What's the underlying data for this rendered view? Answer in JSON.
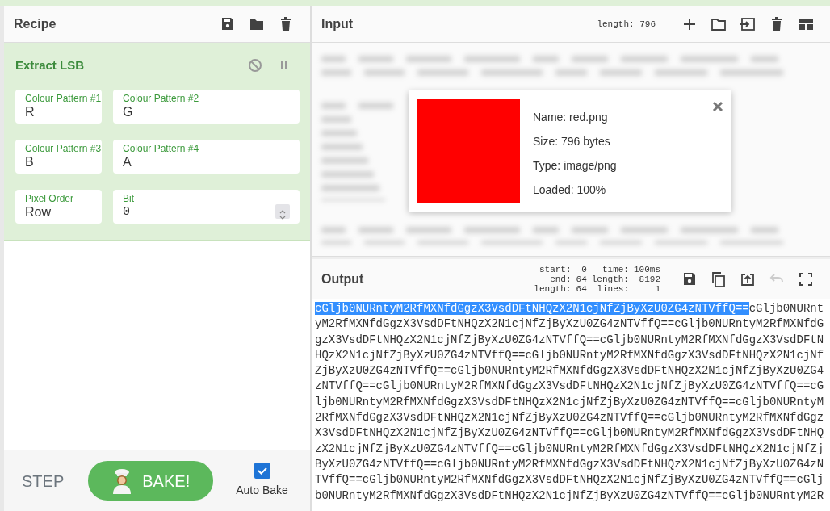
{
  "recipe": {
    "title": "Recipe",
    "buttons": [
      {
        "kind": "save"
      },
      {
        "kind": "folder"
      },
      {
        "kind": "trash"
      }
    ]
  },
  "operation": {
    "name": "Extract LSB",
    "buttons": [
      {
        "kind": "disable"
      },
      {
        "kind": "pause"
      }
    ],
    "fields": [
      {
        "label": "Colour Pattern #1",
        "value": "R",
        "kind": "text"
      },
      {
        "label": "Colour Pattern #2",
        "value": "G",
        "kind": "text"
      },
      {
        "label": "Colour Pattern #3",
        "value": "B",
        "kind": "text"
      },
      {
        "label": "Colour Pattern #4",
        "value": "A",
        "kind": "text"
      },
      {
        "label": "Pixel Order",
        "value": "Row",
        "kind": "text"
      },
      {
        "label": "Bit",
        "value": "0",
        "kind": "number"
      }
    ]
  },
  "controls": {
    "step": "STEP",
    "bake": "BAKE!",
    "auto_bake": {
      "label": "Auto Bake",
      "checked": true
    }
  },
  "input": {
    "title": "Input",
    "length": "length: 796",
    "buttons": [
      {
        "kind": "add"
      },
      {
        "kind": "folder-outline"
      },
      {
        "kind": "import"
      },
      {
        "kind": "trash"
      },
      {
        "kind": "layout"
      }
    ],
    "file": {
      "name": "Name: red.png",
      "size": "Size: 796 bytes",
      "type": "Type: image/png",
      "loaded": "Loaded: 100%",
      "color": "#ff0000"
    }
  },
  "output": {
    "title": "Output",
    "stats": [
      {
        "label": "start:",
        "value": "0"
      },
      {
        "label": "end:",
        "value": "64"
      },
      {
        "label": "length:",
        "value": "64"
      },
      {
        "label": "time:",
        "value": "100ms"
      },
      {
        "label": "length:",
        "value": "8192"
      },
      {
        "label": "lines:",
        "value": "1"
      }
    ],
    "buttons": [
      {
        "kind": "save",
        "disabled": false
      },
      {
        "kind": "copy",
        "disabled": false
      },
      {
        "kind": "replace",
        "disabled": false
      },
      {
        "kind": "undo",
        "disabled": true
      },
      {
        "kind": "maximise",
        "disabled": false
      }
    ],
    "selection": "cGljb0NURntyM2RfMXNfdGgzX3VsdDFtNHQzX2N1cjNfZjByXzU0ZG4zNTVffQ==",
    "lines": [
      "cGljb0NURnt",
      "yM2RfMXNfdGgzX3VsdDFtNHQzX2N1cjNfZjByXzU0ZG4zNTVffQ==cGljb0NURntyM2RfMXNfdG",
      "gzX3VsdDFtNHQzX2N1cjNfZjByXzU0ZG4zNTVffQ==cGljb0NURntyM2RfMXNfdGgzX3VsdDFtN",
      "HQzX2N1cjNfZjByXzU0ZG4zNTVffQ==cGljb0NURntyM2RfMXNfdGgzX3VsdDFtNHQzX2N1cjNf",
      "ZjByXzU0ZG4zNTVffQ==cGljb0NURntyM2RfMXNfdGgzX3VsdDFtNHQzX2N1cjNfZjByXzU0ZG4",
      "zNTVffQ==cGljb0NURntyM2RfMXNfdGgzX3VsdDFtNHQzX2N1cjNfZjByXzU0ZG4zNTVffQ==cG",
      "ljb0NURntyM2RfMXNfdGgzX3VsdDFtNHQzX2N1cjNfZjByXzU0ZG4zNTVffQ==cGljb0NURntyM",
      "2RfMXNfdGgzX3VsdDFtNHQzX2N1cjNfZjByXzU0ZG4zNTVffQ==cGljb0NURntyM2RfMXNfdGgz",
      "X3VsdDFtNHQzX2N1cjNfZjByXzU0ZG4zNTVffQ==cGljb0NURntyM2RfMXNfdGgzX3VsdDFtNHQ",
      "zX2N1cjNfZjByXzU0ZG4zNTVffQ==cGljb0NURntyM2RfMXNfdGgzX3VsdDFtNHQzX2N1cjNfZj",
      "ByXzU0ZG4zNTVffQ==cGljb0NURntyM2RfMXNfdGgzX3VsdDFtNHQzX2N1cjNfZjByXzU0ZG4zN",
      "TVffQ==cGljb0NURntyM2RfMXNfdGgzX3VsdDFtNHQzX2N1cjNfZjByXzU0ZG4zNTVffQ==cGlj",
      "b0NURntyM2RfMXNfdGgzX3VsdDFtNHQzX2N1cjNfZjByXzU0ZG4zNTVffQ==cGljb0NURntyM2R"
    ]
  }
}
